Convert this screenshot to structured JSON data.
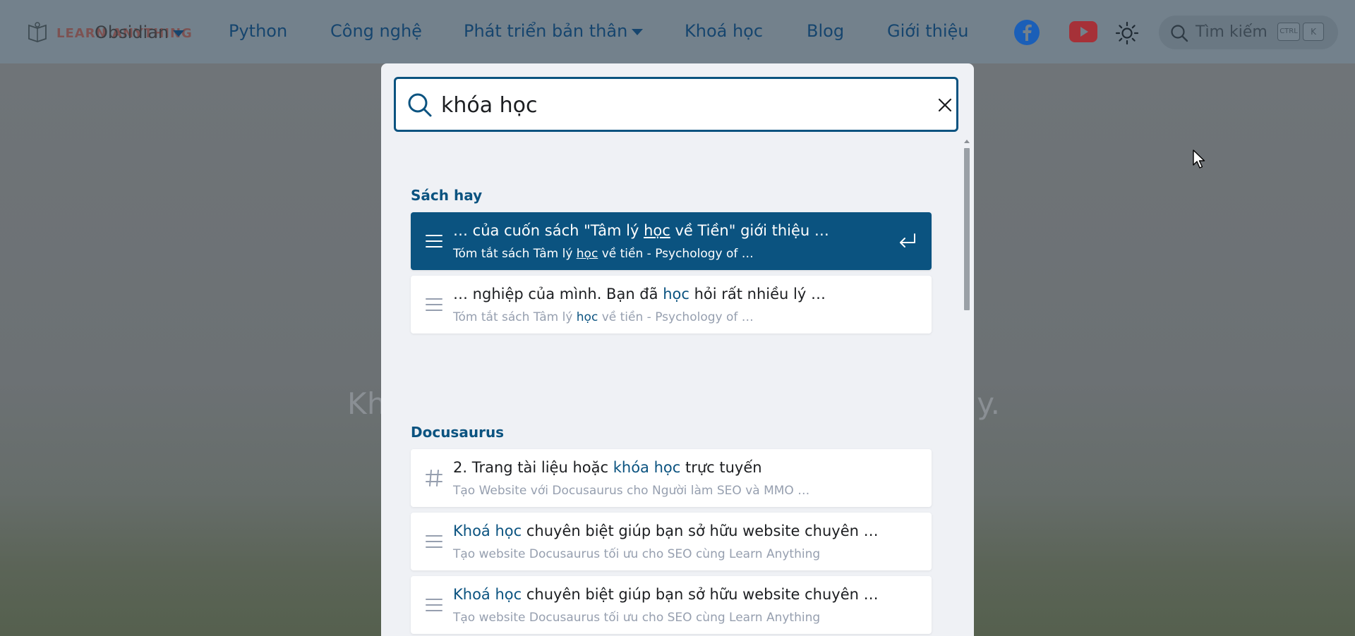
{
  "navbar": {
    "brand": "LEARN ANYTHING",
    "overlay_item": "Obsidian",
    "items": [
      "Python",
      "Công nghệ",
      "Phát triển bản thân",
      "Khoá học",
      "Blog",
      "Giới thiệu"
    ],
    "icons": [
      "facebook-icon",
      "youtube-icon",
      "sun-icon"
    ],
    "search_placeholder": "Tìm kiếm",
    "kbd_ctrl": "CTRL",
    "kbd_k": "K"
  },
  "hero": {
    "left_fragment": "Kh",
    "right_fragment": "ày."
  },
  "search": {
    "query": "khóa học"
  },
  "groups": [
    {
      "title": "Sách hay",
      "hits": [
        {
          "icon": "content-lines-icon",
          "title_before": "… của cuốn sách \"Tâm lý ",
          "title_match": "học",
          "title_after": " về Tiền\" giới thiệu …",
          "sub_before": "Tóm tắt sách Tâm lý ",
          "sub_match": "học",
          "sub_after": " về tiền - Psychology of …",
          "selected": true
        },
        {
          "icon": "content-lines-icon",
          "title_before": "… nghiệp của mình. Bạn đã ",
          "title_match": "học",
          "title_after": " hỏi rất nhiều lý …",
          "sub_before": "Tóm tắt sách Tâm lý ",
          "sub_match": "học",
          "sub_after": " về tiền - Psychology of …",
          "selected": false
        }
      ]
    },
    {
      "title": "Docusaurus",
      "hits": [
        {
          "icon": "hash-icon",
          "title_before": "2. Trang tài liệu hoặc ",
          "title_match": "khóa học",
          "title_after": " trực tuyến",
          "sub_before": "Tạo Website với Docusaurus cho Người làm SEO và MMO …",
          "sub_match": "",
          "sub_after": "",
          "selected": false
        },
        {
          "icon": "content-lines-icon",
          "title_before": "",
          "title_match": "Khoá học",
          "title_after": " chuyên biệt giúp bạn sở hữu website chuyên …",
          "sub_before": "Tạo website Docusaurus tối ưu cho SEO cùng Learn Anything",
          "sub_match": "",
          "sub_after": "",
          "selected": false
        },
        {
          "icon": "content-lines-icon",
          "title_before": "",
          "title_match": "Khoá học",
          "title_after": " chuyên biệt giúp bạn sở hữu website chuyên …",
          "sub_before": "Tạo website Docusaurus tối ưu cho SEO cùng Learn Anything",
          "sub_match": "",
          "sub_after": "",
          "selected": false
        }
      ]
    }
  ],
  "colors": {
    "accent": "#0b5380",
    "nav_text": "#16456e",
    "modal_bg": "#eff1f5",
    "muted_text": "#969faf"
  }
}
